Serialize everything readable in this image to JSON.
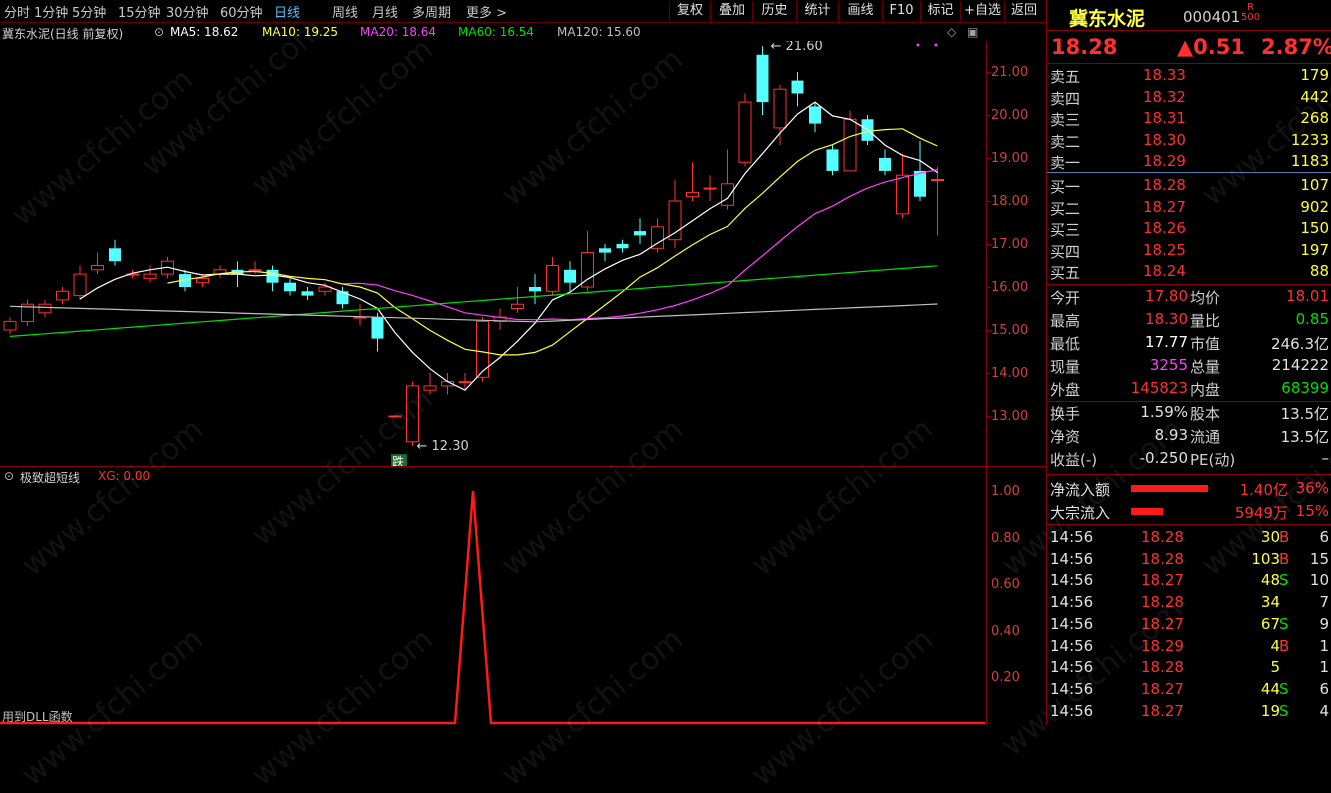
{
  "toolbar": {
    "periods": [
      "分时",
      "1分钟",
      "5分钟",
      "15分钟",
      "30分钟",
      "60分钟",
      "日线",
      "周线",
      "月线",
      "多周期",
      "更多 >"
    ],
    "active_period": "日线",
    "buttons": [
      "复权",
      "叠加",
      "历史",
      "统计",
      "画线",
      "F10",
      "标记",
      "+自选",
      "返回"
    ]
  },
  "chart_info": {
    "stock_label": "冀东水泥(日线 前复权)",
    "ma5": "MA5: 18.62",
    "ma10": "MA10: 19.25",
    "ma20": "MA20: 18.64",
    "ma60": "MA60: 16.54",
    "ma120": "MA120: 15.60",
    "high_mark": "21.60",
    "low_mark": "12.30",
    "low_tag": "跌"
  },
  "price_axis": [
    "21.00",
    "20.00",
    "19.00",
    "18.00",
    "17.00",
    "16.00",
    "15.00",
    "14.00",
    "13.00"
  ],
  "indicator": {
    "name": "极致超短线",
    "value": "XG: 0.00",
    "axis": [
      "1.00",
      "0.80",
      "0.60",
      "0.40",
      "0.20"
    ],
    "footer": "用到DLL函数"
  },
  "colors": {
    "up": "#ff3030",
    "down": "#54ffff",
    "ma5": "#ffffff",
    "ma10": "#ffff3a",
    "ma20": "#ff40ff",
    "ma60": "#00e000",
    "ma120": "#c0c0c0",
    "border": "#880000"
  },
  "stock": {
    "name": "冀东水泥",
    "code": "000401",
    "badge_top": "R",
    "badge_bottom": "500",
    "price": "18.28",
    "change": "▲0.51",
    "pct": "2.87%"
  },
  "sell_orders": [
    {
      "label": "卖五",
      "price": "18.33",
      "vol": "179"
    },
    {
      "label": "卖四",
      "price": "18.32",
      "vol": "442"
    },
    {
      "label": "卖三",
      "price": "18.31",
      "vol": "268"
    },
    {
      "label": "卖二",
      "price": "18.30",
      "vol": "1233"
    },
    {
      "label": "卖一",
      "price": "18.29",
      "vol": "1183"
    }
  ],
  "buy_orders": [
    {
      "label": "买一",
      "price": "18.28",
      "vol": "107"
    },
    {
      "label": "买二",
      "price": "18.27",
      "vol": "902"
    },
    {
      "label": "买三",
      "price": "18.26",
      "vol": "150"
    },
    {
      "label": "买四",
      "price": "18.25",
      "vol": "197"
    },
    {
      "label": "买五",
      "price": "18.24",
      "vol": "88"
    }
  ],
  "stats": [
    {
      "l1": "今开",
      "v1": "17.80",
      "l2": "均价",
      "v2": "18.01"
    },
    {
      "l1": "最高",
      "v1": "18.30",
      "l2": "量比",
      "v2": "0.85"
    },
    {
      "l1": "最低",
      "v1": "17.77",
      "l2": "市值",
      "v2": "246.3亿"
    },
    {
      "l1": "现量",
      "v1": "3255",
      "l2": "总量",
      "v2": "214222"
    },
    {
      "l1": "外盘",
      "v1": "145823",
      "l2": "内盘",
      "v2": "68399"
    }
  ],
  "stats2": [
    {
      "l1": "换手",
      "v1": "1.59%",
      "l2": "股本",
      "v2": "13.5亿"
    },
    {
      "l1": "净资",
      "v1": "8.93",
      "l2": "流通",
      "v2": "13.5亿"
    },
    {
      "l1": "收益(-)",
      "v1": "-0.250",
      "l2": "PE(动)",
      "v2": "–"
    }
  ],
  "flows": [
    {
      "label": "净流入额",
      "value": "1.40亿",
      "pct": "36%",
      "bar": 0.36
    },
    {
      "label": "大宗流入",
      "value": "5949万",
      "pct": "15%",
      "bar": 0.15
    }
  ],
  "ticks": [
    {
      "time": "14:56",
      "price": "18.28",
      "vol": "30",
      "bs": "B",
      "n": "6"
    },
    {
      "time": "14:56",
      "price": "18.28",
      "vol": "103",
      "bs": "B",
      "n": "15"
    },
    {
      "time": "14:56",
      "price": "18.27",
      "vol": "48",
      "bs": "S",
      "n": "10"
    },
    {
      "time": "14:56",
      "price": "18.28",
      "vol": "34",
      "bs": "",
      "n": "7"
    },
    {
      "time": "14:56",
      "price": "18.27",
      "vol": "67",
      "bs": "S",
      "n": "9"
    },
    {
      "time": "14:56",
      "price": "18.29",
      "vol": "4",
      "bs": "B",
      "n": "1"
    },
    {
      "time": "14:56",
      "price": "18.28",
      "vol": "5",
      "bs": "",
      "n": "1"
    },
    {
      "time": "14:56",
      "price": "18.27",
      "vol": "44",
      "bs": "S",
      "n": "6"
    },
    {
      "time": "14:56",
      "price": "18.27",
      "vol": "19",
      "bs": "S",
      "n": "4"
    }
  ],
  "watermark": "www.cfchi.com"
}
